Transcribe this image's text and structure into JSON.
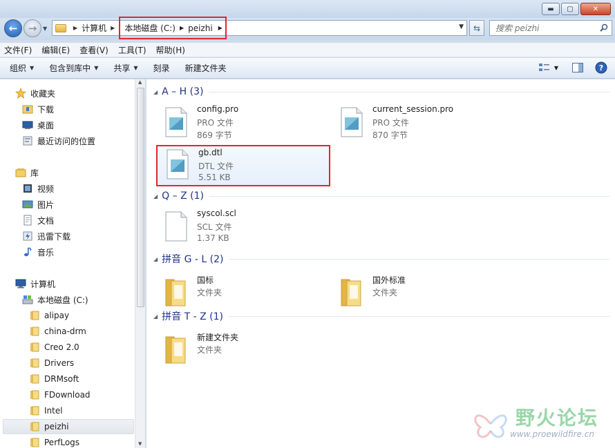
{
  "window": {
    "min_glyph": "▬",
    "max_glyph": "▢",
    "close_glyph": "✕"
  },
  "address": {
    "root_label": "计算机",
    "crumbs": [
      "本地磁盘 (C:)",
      "peizhi"
    ]
  },
  "search": {
    "placeholder": "搜索 peizhi"
  },
  "menu": [
    "文件(F)",
    "编辑(E)",
    "查看(V)",
    "工具(T)",
    "帮助(H)"
  ],
  "toolbar": {
    "organize": "组织",
    "include_in_library": "包含到库中",
    "share": "共享",
    "burn": "刻录",
    "new_folder": "新建文件夹"
  },
  "nav": {
    "favorites": "收藏夹",
    "downloads": "下载",
    "desktop": "桌面",
    "recent": "最近访问的位置",
    "libraries": "库",
    "videos": "视频",
    "pictures": "图片",
    "documents": "文档",
    "thunder": "迅雷下载",
    "music": "音乐",
    "computer": "计算机",
    "local_disk": "本地磁盘 (C:)",
    "folders": [
      "alipay",
      "china-drm",
      "Creo 2.0",
      "Drivers",
      "DRMsoft",
      "FDownload",
      "Intel",
      "peizhi",
      "PerfLogs"
    ]
  },
  "groups": [
    {
      "title": "A – H (3)"
    },
    {
      "title": "Q – Z (1)"
    },
    {
      "title": "拼音 G - L (2)"
    },
    {
      "title": "拼音 T - Z (1)"
    }
  ],
  "files": {
    "config": {
      "name": "config.pro",
      "type": "PRO 文件",
      "size": "869 字节"
    },
    "session": {
      "name": "current_session.pro",
      "type": "PRO 文件",
      "size": "870 字节"
    },
    "gb": {
      "name": "gb.dtl",
      "type": "DTL 文件",
      "size": "5.51 KB"
    },
    "syscol": {
      "name": "syscol.scl",
      "type": "SCL 文件",
      "size": "1.37 KB"
    },
    "guobiao": {
      "name": "国标",
      "type": "文件夹"
    },
    "guowai": {
      "name": "国外标准",
      "type": "文件夹"
    },
    "newfolder": {
      "name": "新建文件夹",
      "type": "文件夹"
    }
  },
  "watermark": {
    "title": "野火论坛",
    "url": "www.proewildfire.cn"
  }
}
